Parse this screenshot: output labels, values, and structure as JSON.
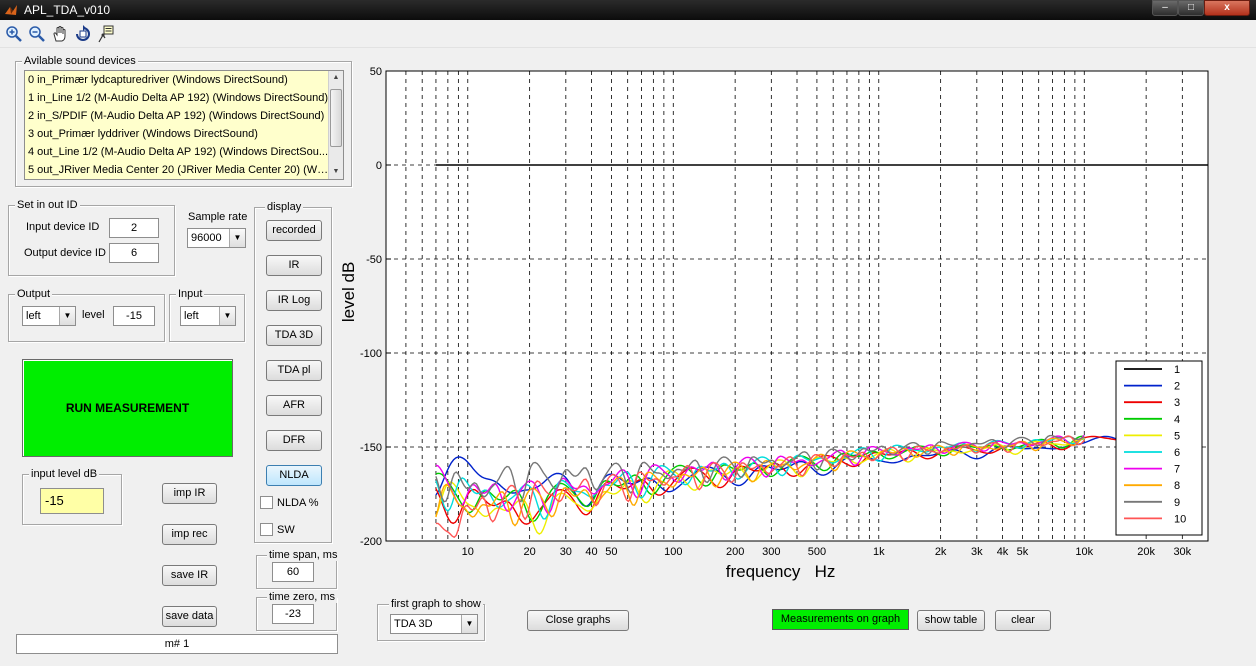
{
  "window": {
    "title": "APL_TDA_v010",
    "min_glyph": "–",
    "max_glyph": "□",
    "close_glyph": "x"
  },
  "toolbar": {
    "icons": [
      "zoom-in-icon",
      "zoom-out-icon",
      "pan-hand-icon",
      "rotate-3d-icon",
      "data-cursor-icon"
    ]
  },
  "devices": {
    "title": "Avilable sound devices",
    "items": [
      "0 in_Primær lydcapturedriver (Windows DirectSound)",
      "1 in_Line 1/2 (M-Audio Delta AP 192) (Windows DirectSound)",
      "2 in_S/PDIF (M-Audio Delta AP 192) (Windows DirectSound)",
      "3 out_Primær lyddriver (Windows DirectSound)",
      "4 out_Line 1/2 (M-Audio Delta AP 192) (Windows DirectSou...",
      "5 out_JRiver Media Center 20 (JRiver Media Center 20) (Win..."
    ]
  },
  "setio": {
    "title": "Set in out ID",
    "input_label": "Input device ID",
    "input_value": "2",
    "output_label": "Output device ID",
    "output_value": "6"
  },
  "sample_rate": {
    "label": "Sample rate",
    "value": "96000"
  },
  "output": {
    "title": "Output",
    "channel": "left",
    "level_label": "level",
    "level_value": "-15"
  },
  "input": {
    "title": "Input",
    "channel": "left"
  },
  "run_button": "RUN MEASUREMENT",
  "input_level": {
    "title": "input level dB",
    "value": "-15"
  },
  "display": {
    "title": "display",
    "buttons": [
      "recorded",
      "IR",
      "IR Log",
      "TDA 3D",
      "TDA pl",
      "AFR",
      "DFR",
      "NLDA"
    ],
    "active": "NLDA",
    "check_nlda": "NLDA %",
    "check_sw": "SW"
  },
  "import_buttons": {
    "imp_ir": "imp IR",
    "imp_rec": "imp rec",
    "save_ir": "save IR",
    "save_data": "save data"
  },
  "time_span": {
    "label": "time span, ms",
    "value": "60"
  },
  "time_zero": {
    "label": "time zero, ms",
    "value": "-23"
  },
  "status": "m# 1",
  "first_graph": {
    "title": "first graph to show",
    "value": "TDA 3D"
  },
  "bottom_buttons": {
    "close_graphs": "Close graphs",
    "measurements": "Measurements on graph",
    "show_table": "show table",
    "clear": "clear"
  },
  "colors": {
    "run_button": "#00ee00",
    "measurements_button": "#00ee00",
    "input_level_bg": "#ffffa6",
    "device_list_bg": "#ffffcc"
  },
  "chart_data": {
    "type": "line",
    "xlabel": "frequency   Hz",
    "ylabel": "level dB",
    "xscale": "log",
    "xlim": [
      4,
      40000
    ],
    "ylim": [
      -200,
      50
    ],
    "yticks": [
      50,
      0,
      -50,
      -100,
      -150,
      -200
    ],
    "xticks": [
      {
        "v": 10,
        "label": "10"
      },
      {
        "v": 20,
        "label": "20"
      },
      {
        "v": 30,
        "label": "30"
      },
      {
        "v": 40,
        "label": "40"
      },
      {
        "v": 50,
        "label": "50"
      },
      {
        "v": 100,
        "label": "100"
      },
      {
        "v": 200,
        "label": "200"
      },
      {
        "v": 300,
        "label": "300"
      },
      {
        "v": 500,
        "label": "500"
      },
      {
        "v": 1000,
        "label": "1k"
      },
      {
        "v": 2000,
        "label": "2k"
      },
      {
        "v": 3000,
        "label": "3k"
      },
      {
        "v": 4000,
        "label": "4k"
      },
      {
        "v": 5000,
        "label": "5k"
      },
      {
        "v": 10000,
        "label": "10k"
      },
      {
        "v": 20000,
        "label": "20k"
      },
      {
        "v": 30000,
        "label": "30k"
      }
    ],
    "grid": true,
    "legend_position": "bottom-right",
    "series": [
      {
        "name": "1",
        "color": "#000000",
        "x": [
          7,
          100,
          1000,
          10000,
          40000
        ],
        "y": [
          0,
          0,
          0,
          0,
          0
        ]
      },
      {
        "name": "2",
        "color": "#0022cc",
        "x": [
          7,
          10,
          20,
          50,
          100,
          500,
          1000,
          5000,
          10000,
          18000
        ],
        "y": [
          -158,
          -160,
          -168,
          -167,
          -165,
          -158,
          -155,
          -150,
          -147,
          -143
        ]
      },
      {
        "name": "3",
        "color": "#ee0000",
        "x": [
          7,
          10,
          20,
          50,
          100,
          500,
          1000,
          5000,
          10000,
          16000
        ],
        "y": [
          -172,
          -175,
          -180,
          -170,
          -165,
          -157,
          -153,
          -149,
          -146,
          -143
        ]
      },
      {
        "name": "4",
        "color": "#00cc00",
        "x": [
          7,
          10,
          20,
          50,
          100,
          500,
          1000,
          5000,
          10000
        ],
        "y": [
          -168,
          -172,
          -176,
          -168,
          -163,
          -156,
          -152,
          -148,
          -145
        ]
      },
      {
        "name": "5",
        "color": "#eeee00",
        "x": [
          7,
          10,
          20,
          50,
          100,
          500,
          1000,
          5000,
          10000
        ],
        "y": [
          -170,
          -176,
          -182,
          -172,
          -165,
          -157,
          -153,
          -149,
          -145
        ]
      },
      {
        "name": "6",
        "color": "#00dddd",
        "x": [
          7,
          10,
          20,
          50,
          100,
          500,
          1000,
          5000,
          10000
        ],
        "y": [
          -166,
          -170,
          -174,
          -167,
          -162,
          -155,
          -151,
          -147,
          -144
        ]
      },
      {
        "name": "7",
        "color": "#ee00ee",
        "x": [
          7,
          10,
          20,
          50,
          100,
          500,
          1000,
          5000,
          10000
        ],
        "y": [
          -164,
          -170,
          -172,
          -166,
          -161,
          -155,
          -151,
          -147,
          -144
        ]
      },
      {
        "name": "8",
        "color": "#ffaa00",
        "x": [
          7,
          10,
          20,
          50,
          100,
          500,
          1000,
          5000,
          10000
        ],
        "y": [
          -172,
          -178,
          -176,
          -170,
          -164,
          -156,
          -152,
          -148,
          -145
        ]
      },
      {
        "name": "9",
        "color": "#777777",
        "x": [
          7,
          10,
          20,
          50,
          100,
          500,
          1000,
          5000,
          10000
        ],
        "y": [
          -162,
          -168,
          -162,
          -162,
          -160,
          -154,
          -150,
          -146,
          -143
        ]
      },
      {
        "name": "10",
        "color": "#ff5555",
        "x": [
          7,
          10,
          20,
          50,
          100,
          500,
          1000,
          5000,
          10000
        ],
        "y": [
          -195,
          -180,
          -172,
          -168,
          -163,
          -156,
          -152,
          -148,
          -144
        ]
      }
    ]
  }
}
